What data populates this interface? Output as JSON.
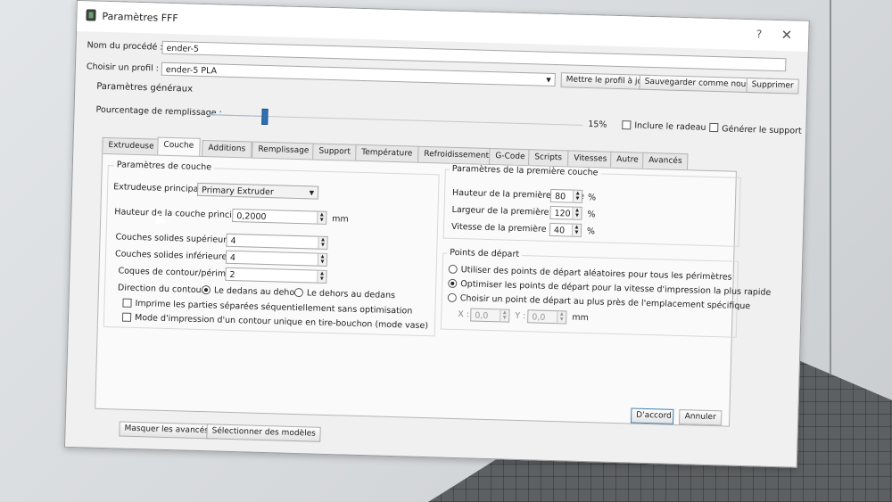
{
  "window": {
    "title": "Paramètres FFF",
    "help": "?",
    "close": "✕"
  },
  "form": {
    "process_name_label": "Nom du procédé :",
    "process_name_value": "ender-5",
    "profile_label": "Choisir un profil :",
    "profile_value": "ender-5 PLA",
    "update_profile": "Mettre le profil à jour",
    "save_new": "Sauvegarder comme nouveau",
    "delete": "Supprimer"
  },
  "general": {
    "title": "Paramètres généraux",
    "infill_label": "Pourcentage de remplissage :",
    "infill_value": "15%",
    "infill_fraction": 0.15,
    "include_raft": "Inclure le radeau",
    "generate_support": "Générer le support"
  },
  "tabs": [
    {
      "label": "Extrudeuse"
    },
    {
      "label": "Couche"
    },
    {
      "label": "Additions"
    },
    {
      "label": "Remplissage"
    },
    {
      "label": "Support"
    },
    {
      "label": "Température"
    },
    {
      "label": "Refroidissement"
    },
    {
      "label": "G-Code"
    },
    {
      "label": "Scripts"
    },
    {
      "label": "Vitesses"
    },
    {
      "label": "Autre"
    },
    {
      "label": "Avancés"
    }
  ],
  "layer": {
    "group_title": "Paramètres de couche",
    "main_extruder_label": "Extrudeuse principale",
    "main_extruder_value": "Primary Extruder",
    "layer_height_label": "Hauteur de la couche principale",
    "layer_height_value": "0,2000",
    "layer_height_unit": "mm",
    "top_layers_label": "Couches solides supérieures",
    "top_layers_value": "4",
    "bottom_layers_label": "Couches solides inférieures",
    "bottom_layers_value": "4",
    "perimeters_label": "Coques de contour/périmètre",
    "perimeters_value": "2",
    "direction_label": "Direction du contour :",
    "dir_inside_out": "Le dedans au dehors",
    "dir_outside_in": "Le dehors au dedans",
    "sequential_print": "Imprime les parties séparées séquentiellement sans optimisation",
    "vase_mode": "Mode d'impression d'un contour unique en tire-bouchon (mode vase)"
  },
  "first_layer": {
    "group_title": "Paramètres de la première couche",
    "height_label": "Hauteur de la première couche",
    "height_value": "80",
    "width_label": "Largeur de la première couche",
    "width_value": "120",
    "speed_label": "Vitesse de la première couche",
    "speed_value": "40",
    "unit": "%"
  },
  "start_points": {
    "group_title": "Points de départ",
    "random": "Utiliser des points de départ aléatoires pour tous les périmètres",
    "optimize": "Optimiser les points de départ pour la vitesse d'impression la plus rapide",
    "nearest": "Choisir un point de départ au plus près de l'emplacement spécifique",
    "x_label": "X :",
    "x_value": "0,0",
    "y_label": "Y :",
    "y_value": "0,0",
    "unit": "mm"
  },
  "footer": {
    "hide_advanced": "Masquer les avancés",
    "select_models": "Sélectionner des modèles",
    "ok": "D'accord",
    "cancel": "Annuler"
  },
  "colors": {
    "accent": "#2f6fb5",
    "panel": "#fafafa",
    "dialog": "#f0f0f0"
  }
}
